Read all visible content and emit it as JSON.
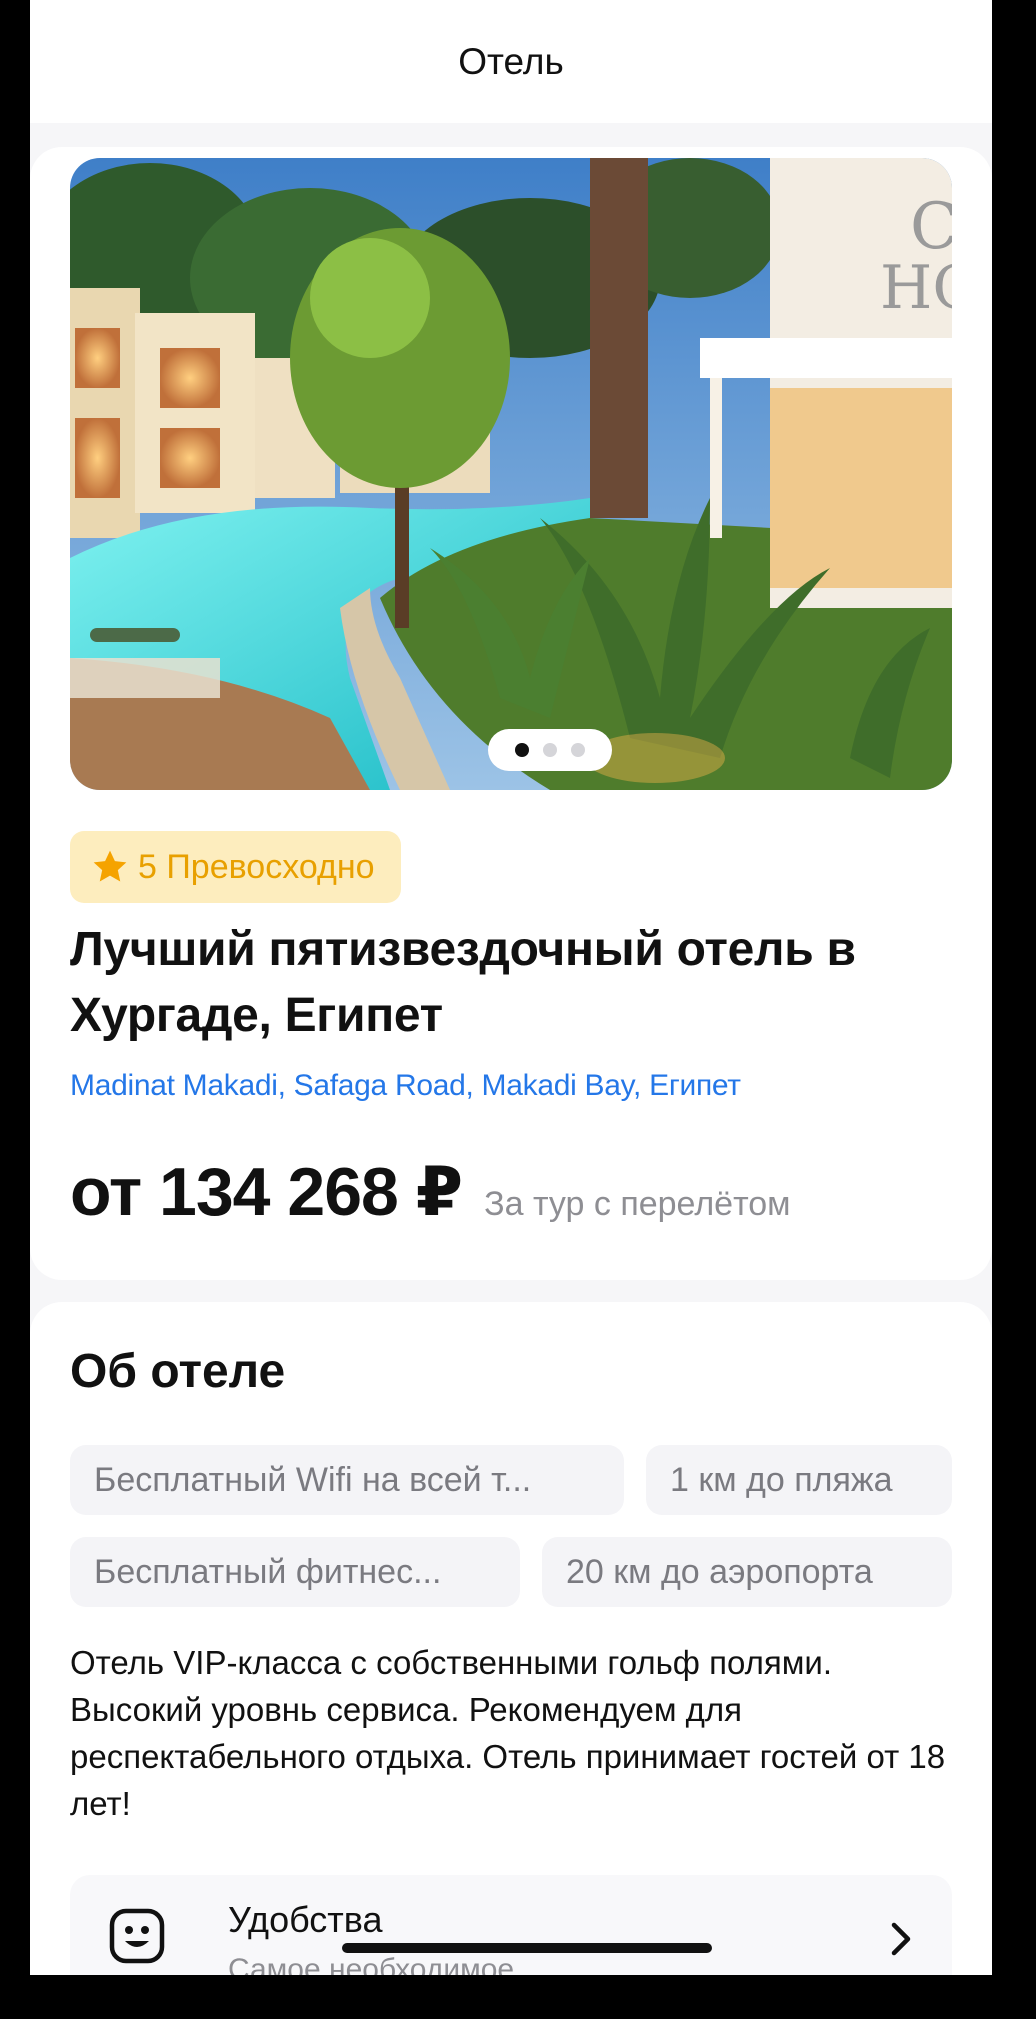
{
  "nav": {
    "title": "Отель"
  },
  "hotel": {
    "gallery": {
      "slide_count": 3,
      "active_slide": 1
    },
    "rating": {
      "icon": "star-icon",
      "text": "5 Превосходно",
      "color": "#e8a000"
    },
    "title": "Лучший пятизвездочный отель в Хургаде, Египет",
    "address": "Madinat Makadi, Safaga Road, Makadi Bay, Египет",
    "price": "от 134 268 ₽",
    "price_note": "За тур с перелётом"
  },
  "about": {
    "title": "Об отеле",
    "chips": [
      "Бесплатный Wifi на всей т...",
      "1 км до пляжа",
      "Бесплатный фитнес...",
      "20 км до аэропорта"
    ],
    "description": "Отель VIP-класса с собственными гольф полями. Высокий уровнь сервиса. Рекомендуем для респектабельного отдыха. Отель принимает гостей от 18 лет!",
    "amenities": {
      "icon": "smiley-icon",
      "title": "Удобства",
      "subtitle": "Самое необходимое"
    }
  },
  "colors": {
    "accent": "#2477e8",
    "badge_bg": "#fdedbe"
  }
}
